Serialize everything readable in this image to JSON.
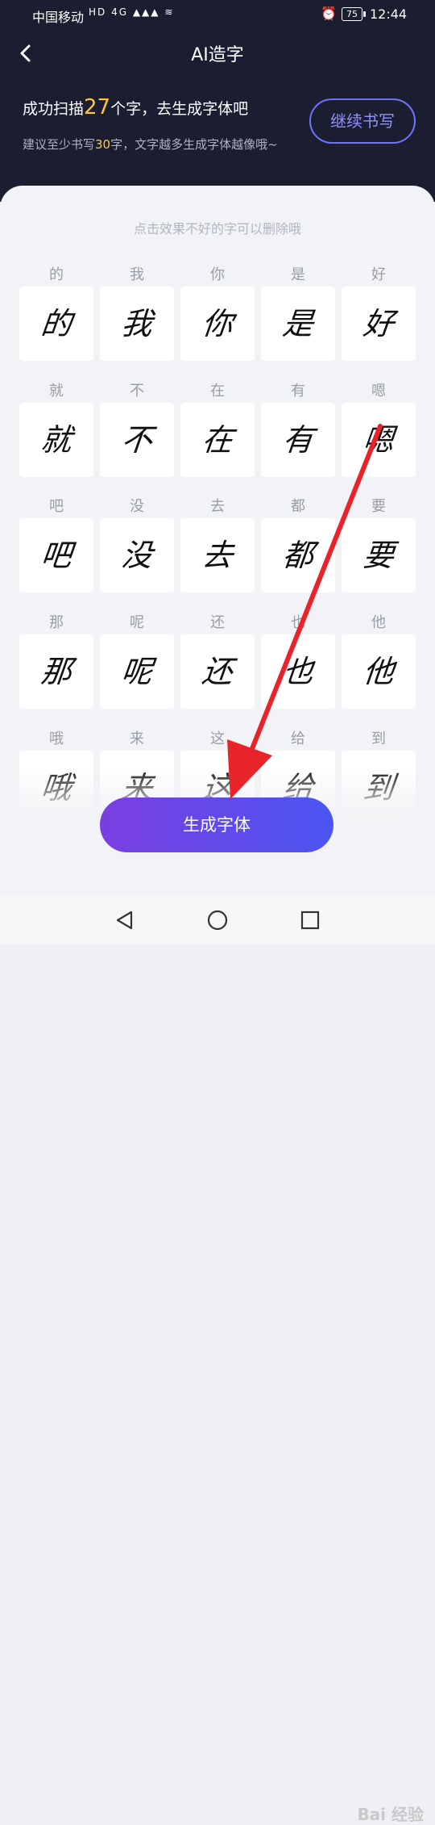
{
  "status_bar": {
    "carrier": "中国移动",
    "network_icons": "HD 4G ▲▲▲ ≋",
    "battery": "75",
    "time": "12:44"
  },
  "header": {
    "title": "AI造字"
  },
  "summary": {
    "text_before": "成功扫描",
    "count": "27",
    "text_after": "个字，去生成字体吧",
    "suggest_before": "建议至少书写",
    "suggest_count": "30",
    "suggest_after": "字，文字越多生成字体越像哦~",
    "continue_button": "继续书写"
  },
  "panel": {
    "hint": "点击效果不好的字可以删除哦",
    "characters": [
      "的",
      "我",
      "你",
      "是",
      "好",
      "就",
      "不",
      "在",
      "有",
      "嗯",
      "吧",
      "没",
      "去",
      "都",
      "要",
      "那",
      "呢",
      "还",
      "也",
      "他",
      "哦",
      "来",
      "这",
      "给",
      "到"
    ]
  },
  "generate_button": "生成字体",
  "watermark": "Bai 经验",
  "colors": {
    "header_bg": "#1b1d30",
    "accent_yellow": "#ffc83a",
    "button_start": "#7a3ee0",
    "button_end": "#4a55f2",
    "arrow": "#e8232a"
  }
}
